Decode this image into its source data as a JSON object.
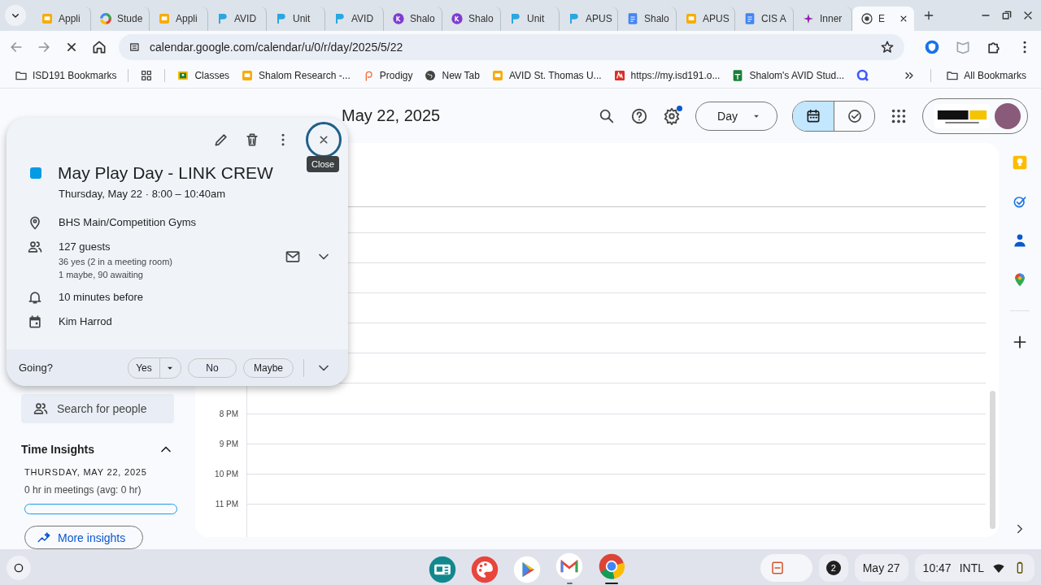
{
  "browser": {
    "tabs": [
      {
        "title": "Appli",
        "kind": "slides",
        "selected": false
      },
      {
        "title": "Stude",
        "kind": "ring",
        "selected": false
      },
      {
        "title": "Appli",
        "kind": "slides",
        "selected": false
      },
      {
        "title": "AVID",
        "kind": "flag",
        "selected": false
      },
      {
        "title": "Unit",
        "kind": "flag",
        "selected": false
      },
      {
        "title": "AVID",
        "kind": "flag",
        "selected": false
      },
      {
        "title": "Shalo",
        "kind": "dot",
        "selected": false
      },
      {
        "title": "Shalo",
        "kind": "dot",
        "selected": false
      },
      {
        "title": "Unit",
        "kind": "flag",
        "selected": false
      },
      {
        "title": "APUS",
        "kind": "flag",
        "selected": false
      },
      {
        "title": "Shalo",
        "kind": "docs",
        "selected": false
      },
      {
        "title": "APUS",
        "kind": "slides",
        "selected": false
      },
      {
        "title": "CIS A",
        "kind": "docs",
        "selected": false
      },
      {
        "title": "Inner",
        "kind": "star",
        "selected": false
      },
      {
        "title": "E",
        "kind": "globe",
        "selected": true
      }
    ],
    "url": "calendar.google.com/calendar/u/0/r/day/2025/5/22",
    "bookmarks": [
      {
        "label": "ISD191 Bookmarks",
        "kind": "folder"
      },
      {
        "kind": "grid"
      },
      {
        "label": "Classes",
        "kind": "classroom"
      },
      {
        "label": "Shalom Research -...",
        "kind": "slides"
      },
      {
        "label": "Prodigy",
        "kind": "prodigy"
      },
      {
        "label": "New Tab",
        "kind": "globe"
      },
      {
        "label": "AVID St. Thomas U...",
        "kind": "slides"
      },
      {
        "label": "https://my.isd191.o...",
        "kind": "red"
      },
      {
        "label": "Shalom's AVID Stud...",
        "kind": "sheets"
      },
      {
        "kind": "search"
      }
    ],
    "all_bookmarks": "All Bookmarks"
  },
  "header": {
    "date_title": "May 22, 2025",
    "settings_badge": true,
    "view_dropdown": "Day",
    "view_toggle": [
      {
        "kind": "calendar",
        "selected": true
      },
      {
        "kind": "tasks",
        "selected": false
      }
    ]
  },
  "event_popup": {
    "color": "#039be5",
    "title": "May Play Day - LINK CREW",
    "when": "Thursday, May 22  ·  8:00 – 10:40am",
    "tooltip": "Close",
    "details": [
      {
        "kind": "location",
        "title": "BHS Main/Competition Gyms"
      },
      {
        "kind": "guests",
        "title": "127 guests",
        "lines": [
          "36 yes (2 in a meeting room)",
          "1 maybe, 90 awaiting"
        ]
      },
      {
        "kind": "reminder",
        "title": "10 minutes before"
      },
      {
        "kind": "calendar",
        "title": "Kim Harrod"
      }
    ],
    "rsvp": {
      "label": "Going?",
      "options": [
        {
          "label": "Yes",
          "selected": false,
          "kind": "split"
        },
        {
          "label": "No",
          "selected": false,
          "kind": "plain"
        },
        {
          "label": "Maybe",
          "selected": false,
          "kind": "plain"
        }
      ]
    }
  },
  "sidebar": {
    "search_people": {
      "placeholder": "Search for people"
    },
    "time_insights": {
      "heading": "Time Insights",
      "expanded": true,
      "date": "THURSDAY, MAY 22, 2025",
      "summary": "0 hr in meetings (avg: 0 hr)",
      "level": 0,
      "button": "More insights"
    }
  },
  "grid": {
    "time_labels": [
      "8 PM",
      "9 PM",
      "10 PM",
      "11 PM"
    ]
  },
  "shelf": {
    "apps": [
      {
        "kind": "news",
        "open": false,
        "focused": false
      },
      {
        "kind": "palette",
        "open": false,
        "focused": false
      },
      {
        "kind": "play",
        "open": false,
        "focused": false
      },
      {
        "kind": "gmail",
        "open": true,
        "focused": false
      },
      {
        "kind": "chrome",
        "open": true,
        "focused": true
      }
    ],
    "notification_count": "2",
    "date": "May 27",
    "time": "10:47",
    "ime": "INTL"
  }
}
